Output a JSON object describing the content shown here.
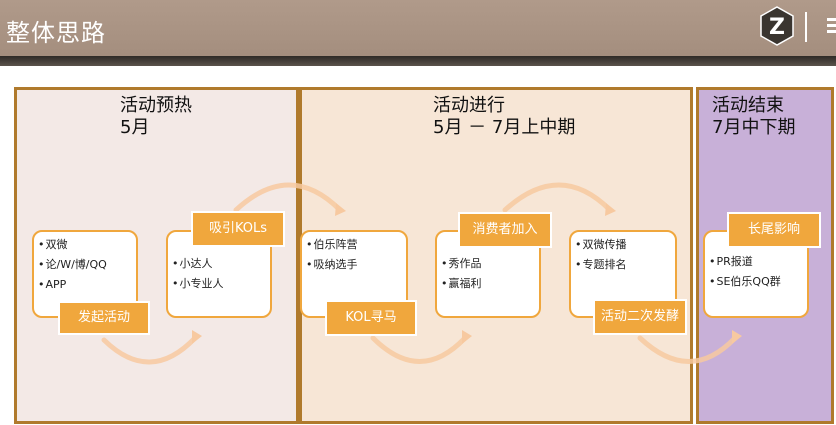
{
  "header": {
    "title": "整体思路",
    "logo_icon": "z-logo-icon"
  },
  "colors": {
    "accent": "#f0a73d",
    "border": "#b07a2c",
    "phase1_bg": "#f3e9e6",
    "phase2_bg": "#f7e6d6",
    "phase3_bg": "#c8b0d8"
  },
  "phases": [
    {
      "title": "活动预热",
      "period": "5月"
    },
    {
      "title": "活动进行",
      "period": "5月 － 7月上中期"
    },
    {
      "title": "活动结束",
      "period": "7月中下期"
    }
  ],
  "steps": [
    {
      "label": "发起活动",
      "items": [
        "双微",
        "论/W/博/QQ",
        "APP"
      ]
    },
    {
      "label": "吸引KOLs",
      "items": [
        "小达人",
        "小专业人"
      ]
    },
    {
      "label": "KOL寻马",
      "items": [
        "伯乐阵营",
        "吸纳选手"
      ]
    },
    {
      "label": "消费者加入",
      "items": [
        "秀作品",
        "赢福利"
      ]
    },
    {
      "label": "活动二次发酵",
      "items": [
        "双微传播",
        "专题排名"
      ]
    },
    {
      "label": "长尾影响",
      "items": [
        "PR报道",
        "SE伯乐QQ群"
      ]
    }
  ]
}
